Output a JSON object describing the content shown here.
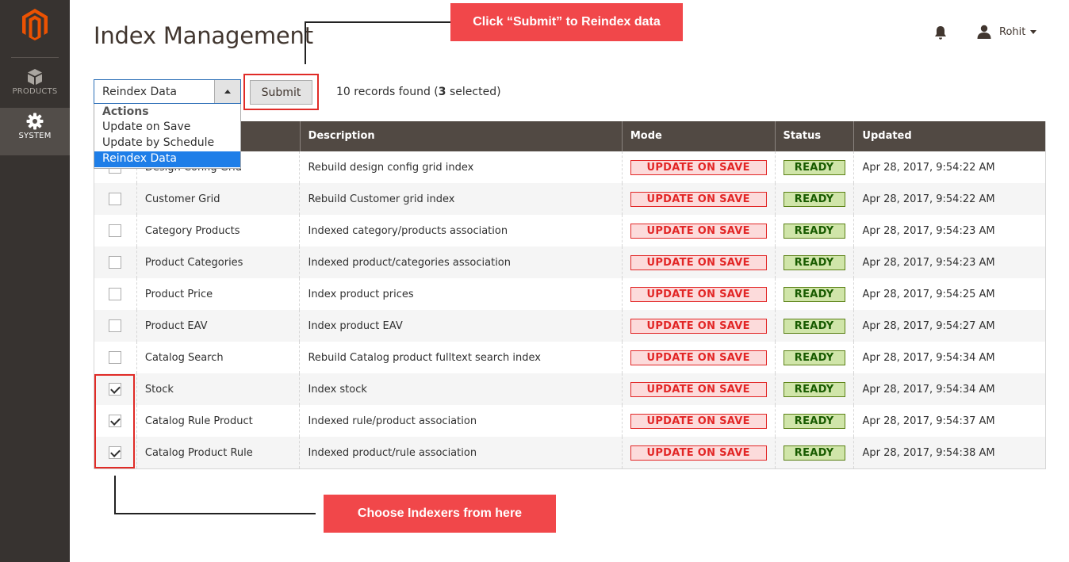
{
  "sidebar": {
    "items": [
      {
        "label": "PRODUCTS",
        "icon": "cube-icon"
      },
      {
        "label": "SYSTEM",
        "icon": "gear-icon"
      }
    ]
  },
  "header": {
    "title": "Index Management",
    "user_name": "Rohit"
  },
  "callouts": {
    "top": "Click “Submit” to Reindex data",
    "bottom": "Choose Indexers from here"
  },
  "toolbar": {
    "selected_action": "Reindex Data",
    "dropdown": {
      "group_label": "Actions",
      "options": [
        "Update on Save",
        "Update by Schedule",
        "Reindex Data"
      ]
    },
    "submit_label": "Submit",
    "records_prefix": "10 records found (",
    "records_selected": "3",
    "records_suffix": " selected)"
  },
  "grid": {
    "columns": [
      "",
      "",
      "Description",
      "Mode",
      "Status",
      "Updated"
    ],
    "rows": [
      {
        "checked": false,
        "indexer": "Design Config Grid",
        "description": "Rebuild design config grid index",
        "mode": "UPDATE ON SAVE",
        "status": "READY",
        "updated": "Apr 28, 2017, 9:54:22 AM"
      },
      {
        "checked": false,
        "indexer": "Customer Grid",
        "description": "Rebuild Customer grid index",
        "mode": "UPDATE ON SAVE",
        "status": "READY",
        "updated": "Apr 28, 2017, 9:54:22 AM"
      },
      {
        "checked": false,
        "indexer": "Category Products",
        "description": "Indexed category/products association",
        "mode": "UPDATE ON SAVE",
        "status": "READY",
        "updated": "Apr 28, 2017, 9:54:23 AM"
      },
      {
        "checked": false,
        "indexer": "Product Categories",
        "description": "Indexed product/categories association",
        "mode": "UPDATE ON SAVE",
        "status": "READY",
        "updated": "Apr 28, 2017, 9:54:23 AM"
      },
      {
        "checked": false,
        "indexer": "Product Price",
        "description": "Index product prices",
        "mode": "UPDATE ON SAVE",
        "status": "READY",
        "updated": "Apr 28, 2017, 9:54:25 AM"
      },
      {
        "checked": false,
        "indexer": "Product EAV",
        "description": "Index product EAV",
        "mode": "UPDATE ON SAVE",
        "status": "READY",
        "updated": "Apr 28, 2017, 9:54:27 AM"
      },
      {
        "checked": false,
        "indexer": "Catalog Search",
        "description": "Rebuild Catalog product fulltext search index",
        "mode": "UPDATE ON SAVE",
        "status": "READY",
        "updated": "Apr 28, 2017, 9:54:34 AM"
      },
      {
        "checked": true,
        "indexer": "Stock",
        "description": "Index stock",
        "mode": "UPDATE ON SAVE",
        "status": "READY",
        "updated": "Apr 28, 2017, 9:54:34 AM"
      },
      {
        "checked": true,
        "indexer": "Catalog Rule Product",
        "description": "Indexed rule/product association",
        "mode": "UPDATE ON SAVE",
        "status": "READY",
        "updated": "Apr 28, 2017, 9:54:37 AM"
      },
      {
        "checked": true,
        "indexer": "Catalog Product Rule",
        "description": "Indexed product/rule association",
        "mode": "UPDATE ON SAVE",
        "status": "READY",
        "updated": "Apr 28, 2017, 9:54:38 AM"
      }
    ]
  },
  "colors": {
    "sidebar_bg": "#373330",
    "header_row_bg": "#514943",
    "callout_bg": "#f1474a",
    "mode_red": "#e22626",
    "status_green": "#185b00",
    "selected_option": "#1e7ee8",
    "logo_orange": "#eb5202"
  }
}
